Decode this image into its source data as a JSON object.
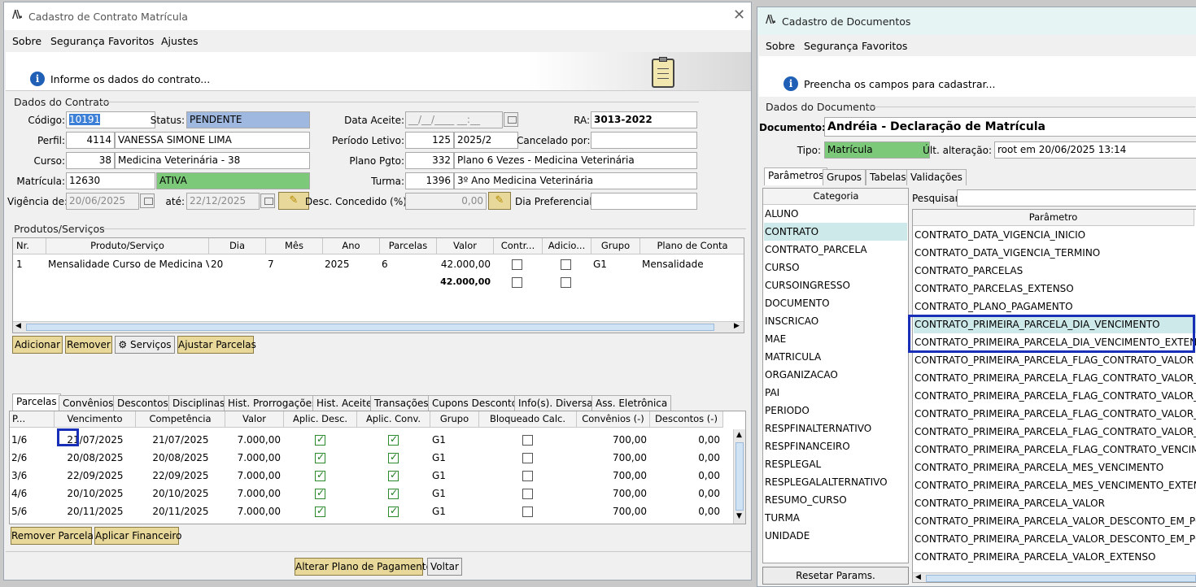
{
  "left": {
    "title": "Cadastro de Contrato Matrícula",
    "menu": [
      "Sobre",
      "Segurança",
      "Favoritos",
      "Ajustes"
    ],
    "info": "Informe os dados do contrato...",
    "sec_contrato": "Dados do Contrato",
    "labels": {
      "codigo": "Código:",
      "status": "Status:",
      "data_aceite": "Data Aceite:",
      "ra": "RA:",
      "perfil": "Perfil:",
      "periodo": "Período Letivo:",
      "cancelado": "Cancelado por:",
      "curso": "Curso:",
      "plano": "Plano Pgto:",
      "matricula": "Matrícula:",
      "turma": "Turma:",
      "vigencia": "Vigência de:",
      "ate": "até:",
      "desc": "Desc. Concedido (%):",
      "dia_pref": "Dia Preferencial:"
    },
    "values": {
      "codigo": "10191",
      "status": "PENDENTE",
      "data_aceite": "__/__/____ __:__",
      "ra": "3013-2022",
      "perfil_id": "4114",
      "perfil_nome": "VANESSA SIMONE LIMA",
      "periodo_id": "125",
      "periodo_nome": "2025/2",
      "curso_id": "38",
      "curso_nome": "Medicina Veterinária - 38",
      "plano_id": "332",
      "plano_nome": "Plano 6 Vezes - Medicina Veterinária",
      "matricula": "12630",
      "matricula_status": "ATIVA",
      "turma_id": "1396",
      "turma_nome": "3º Ano Medicina Veterinária",
      "vig_de": "20/06/2025",
      "vig_ate": "22/12/2025",
      "desc": "0,00"
    },
    "sec_produtos": "Produtos/Serviços",
    "prod_headers": [
      "Nr.",
      "Produto/Serviço",
      "Dia",
      "Mês",
      "Ano",
      "Parcelas",
      "Valor",
      "Contr...",
      "Adicio...",
      "Grupo",
      "Plano de Conta"
    ],
    "prod_row": {
      "nr": "1",
      "produto": "Mensalidade Curso de Medicina Ve...",
      "dia": "20",
      "mes": "7",
      "ano": "2025",
      "parcelas": "6",
      "valor": "42.000,00",
      "grupo": "G1",
      "plano": "Mensalidade"
    },
    "prod_total": "42.000,00",
    "buttons": {
      "adicionar": "Adicionar",
      "remover": "Remover",
      "servicos": "Serviços",
      "ajustar": "Ajustar Parcelas",
      "remover_parcela": "Remover Parcela",
      "aplicar": "Aplicar Financeiro",
      "alterar": "Alterar Plano de Pagamento",
      "voltar": "Voltar"
    },
    "tabs": [
      "Parcelas",
      "Convênios",
      "Descontos",
      "Disciplinas",
      "Hist. Prorrogações",
      "Hist. Aceite",
      "Transações",
      "Cupons Desconto",
      "Info(s). Diversas",
      "Ass. Eletrônica"
    ],
    "parc_headers": [
      "P...",
      "Vencimento",
      "Competência",
      "Valor",
      "Aplic. Desc.",
      "Aplic. Conv.",
      "Grupo",
      "Bloqueado Calc.",
      "Convênios (-)",
      "Descontos (-)"
    ],
    "parcelas": [
      {
        "p": "1/6",
        "venc": "21/07/2025",
        "comp": "21/07/2025",
        "valor": "7.000,00",
        "grupo": "G1",
        "conv": "700,00",
        "desc": "0,00"
      },
      {
        "p": "2/6",
        "venc": "20/08/2025",
        "comp": "20/08/2025",
        "valor": "7.000,00",
        "grupo": "G1",
        "conv": "700,00",
        "desc": "0,00"
      },
      {
        "p": "3/6",
        "venc": "22/09/2025",
        "comp": "22/09/2025",
        "valor": "7.000,00",
        "grupo": "G1",
        "conv": "700,00",
        "desc": "0,00"
      },
      {
        "p": "4/6",
        "venc": "20/10/2025",
        "comp": "20/10/2025",
        "valor": "7.000,00",
        "grupo": "G1",
        "conv": "700,00",
        "desc": "0,00"
      },
      {
        "p": "5/6",
        "venc": "20/11/2025",
        "comp": "20/11/2025",
        "valor": "7.000,00",
        "grupo": "G1",
        "conv": "700,00",
        "desc": "0,00"
      }
    ]
  },
  "right": {
    "title": "Cadastro de Documentos",
    "menu": [
      "Sobre",
      "Segurança",
      "Favoritos"
    ],
    "info": "Preencha os campos para cadastrar...",
    "sec": "Dados do Documento",
    "doc_label": "Documento:",
    "doc_value": "Andréia - Declaração de Matrícula",
    "tipo_label": "Tipo:",
    "tipo_value": "Matrícula",
    "ult_label": "Últ. alteração:",
    "ult_value": "root em 20/06/2025 13:14",
    "tabs": [
      "Parâmetros",
      "Grupos",
      "Tabelas",
      "Validações"
    ],
    "cat_header": "Categoria",
    "categorias": [
      "ALUNO",
      "CONTRATO",
      "CONTRATO_PARCELA",
      "CURSO",
      "CURSOINGRESSO",
      "DOCUMENTO",
      "INSCRICAO",
      "MAE",
      "MATRICULA",
      "ORGANIZACAO",
      "PAI",
      "PERIODO",
      "RESPFINALTERNATIVO",
      "RESPFINANCEIRO",
      "RESPLEGAL",
      "RESPLEGALALTERNATIVO",
      "RESUMO_CURSO",
      "TURMA",
      "UNIDADE"
    ],
    "pesquisar": "Pesquisar:",
    "param_header": "Parâmetro",
    "parametros": [
      "CONTRATO_DATA_VIGENCIA_INICIO",
      "CONTRATO_DATA_VIGENCIA_TERMINO",
      "CONTRATO_PARCELAS",
      "CONTRATO_PARCELAS_EXTENSO",
      "CONTRATO_PLANO_PAGAMENTO",
      "CONTRATO_PRIMEIRA_PARCELA_DIA_VENCIMENTO",
      "CONTRATO_PRIMEIRA_PARCELA_DIA_VENCIMENTO_EXTENSO",
      "CONTRATO_PRIMEIRA_PARCELA_FLAG_CONTRATO_VALOR",
      "CONTRATO_PRIMEIRA_PARCELA_FLAG_CONTRATO_VALOR_EX...",
      "CONTRATO_PRIMEIRA_PARCELA_FLAG_CONTRATO_VALOR_O...",
      "CONTRATO_PRIMEIRA_PARCELA_FLAG_CONTRATO_VALOR_O...",
      "CONTRATO_PRIMEIRA_PARCELA_FLAG_CONTRATO_VALOR_SU...",
      "CONTRATO_PRIMEIRA_PARCELA_FLAG_CONTRATO_VENCIME...",
      "CONTRATO_PRIMEIRA_PARCELA_MES_VENCIMENTO",
      "CONTRATO_PRIMEIRA_PARCELA_MES_VENCIMENTO_EXTENSO",
      "CONTRATO_PRIMEIRA_PARCELA_VALOR",
      "CONTRATO_PRIMEIRA_PARCELA_VALOR_DESCONTO_EM_POR...",
      "CONTRATO_PRIMEIRA_PARCELA_VALOR_DESCONTO_EM_POR...",
      "CONTRATO_PRIMEIRA_PARCELA_VALOR_EXTENSO"
    ],
    "reset": "Resetar Params."
  }
}
